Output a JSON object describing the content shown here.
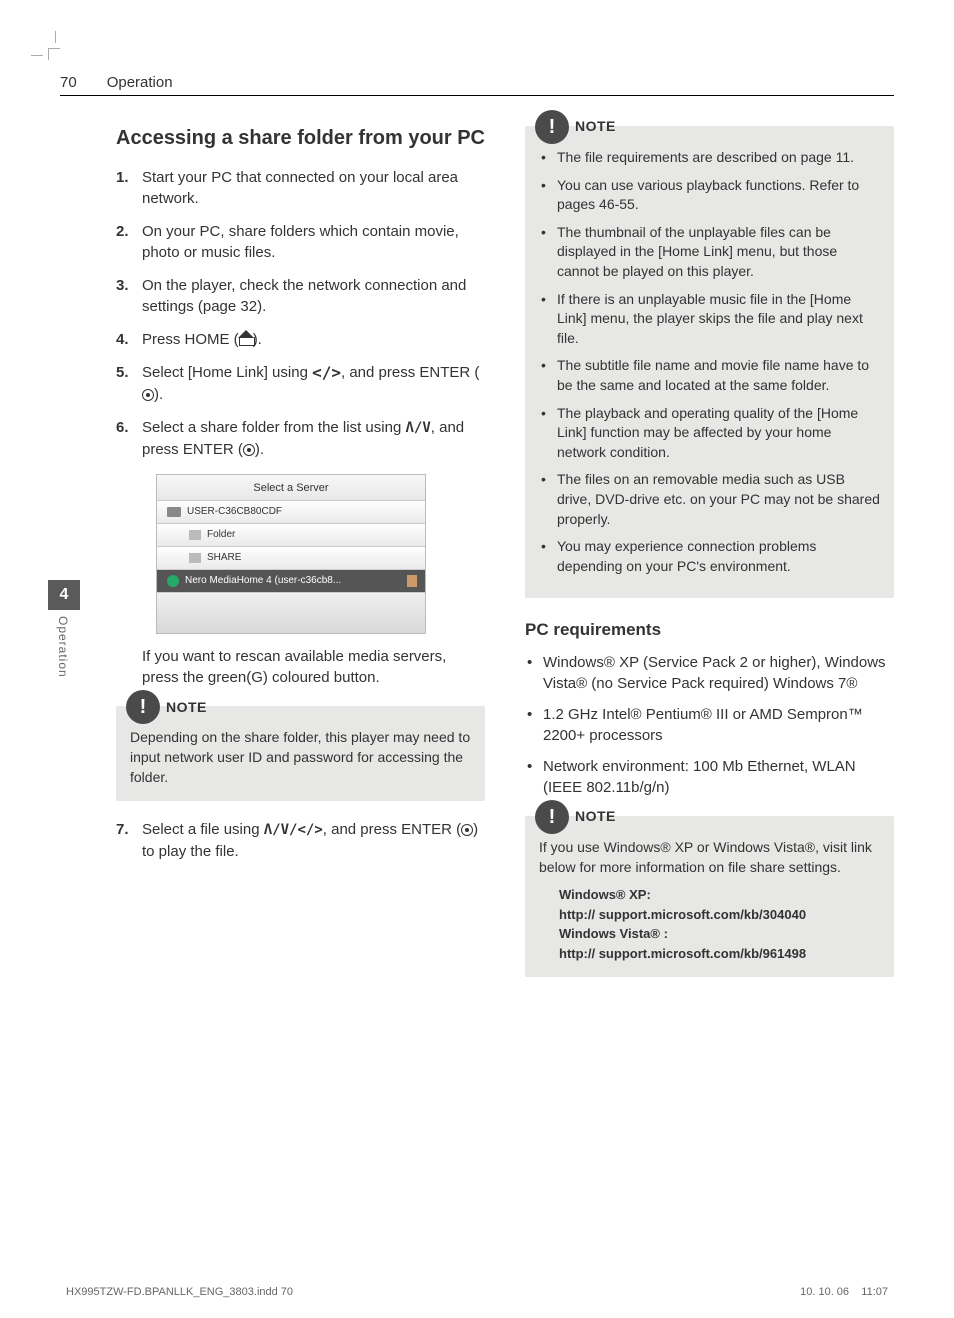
{
  "header": {
    "page_number": "70",
    "section": "Operation"
  },
  "side_tab": {
    "number": "4",
    "label": "Operation"
  },
  "left": {
    "heading": "Accessing a share folder from your PC",
    "steps": {
      "s1": "Start your PC that connected on your local area network.",
      "s2": "On your PC, share folders which contain movie, photo or music files.",
      "s3": "On the player, check the network connection and settings (page 32).",
      "s4a": "Press HOME (",
      "s4b": ").",
      "s5a": "Select [Home Link] using ",
      "s5b": ", and press ENTER (",
      "s5c": ").",
      "s6a": "Select a share folder from the list using ",
      "s6b": ", and press ENTER (",
      "s6c": ").",
      "s7a": "Select a file using ",
      "s7b": ", and press ENTER (",
      "s7c": ") to play the file."
    },
    "after_screenshot": "If you want to rescan available media servers, press the green(G) coloured button.",
    "note1": "Depending on the share folder, this player may need to input network user ID and password for accessing the folder.",
    "screenshot": {
      "title": "Select a Server",
      "row1": "USER-C36CB80CDF",
      "row2": "Folder",
      "row3": "SHARE",
      "row4": "Nero MediaHome 4 (user-c36cb8..."
    }
  },
  "right": {
    "note2_items": {
      "i1": "The file requirements are described on page 11.",
      "i2": "You can use various playback functions. Refer to pages 46-55.",
      "i3": "The thumbnail of the unplayable files can be displayed in the [Home Link] menu, but those cannot be played on this player.",
      "i4": "If there is an unplayable music file in the [Home Link] menu, the player skips the file and play next file.",
      "i5": "The subtitle file name and movie file name have to be the same and located at the same folder.",
      "i6": "The playback and operating quality of the [Home Link] function may be affected by your home network condition.",
      "i7": "The files on an removable media such as USB drive, DVD-drive etc. on your PC may not be shared properly.",
      "i8": "You may experience connection problems depending on your PC's environment."
    },
    "pc_req_heading": "PC requirements",
    "pc_req": {
      "r1": "Windows® XP (Service Pack 2 or higher), Windows Vista® (no Service Pack required) Windows 7®",
      "r2": "1.2 GHz Intel® Pentium® III or AMD Sempron™ 2200+ processors",
      "r3": "Network environment: 100 Mb Ethernet, WLAN (IEEE 802.11b/g/n)"
    },
    "note3_intro": "If you use Windows® XP or Windows Vista®, visit link below for more information on file share settings.",
    "note3_kb": {
      "xp_label": "Windows® XP:",
      "xp_url": "http:// support.microsoft.com/kb/304040",
      "vista_label": "Windows Vista® :",
      "vista_url": "http:// support.microsoft.com/kb/961498"
    }
  },
  "note_label": "NOTE",
  "footer": {
    "file": "HX995TZW-FD.BPANLLK_ENG_3803.indd   70",
    "date": "10. 10. 06",
    "time": "11:07"
  }
}
